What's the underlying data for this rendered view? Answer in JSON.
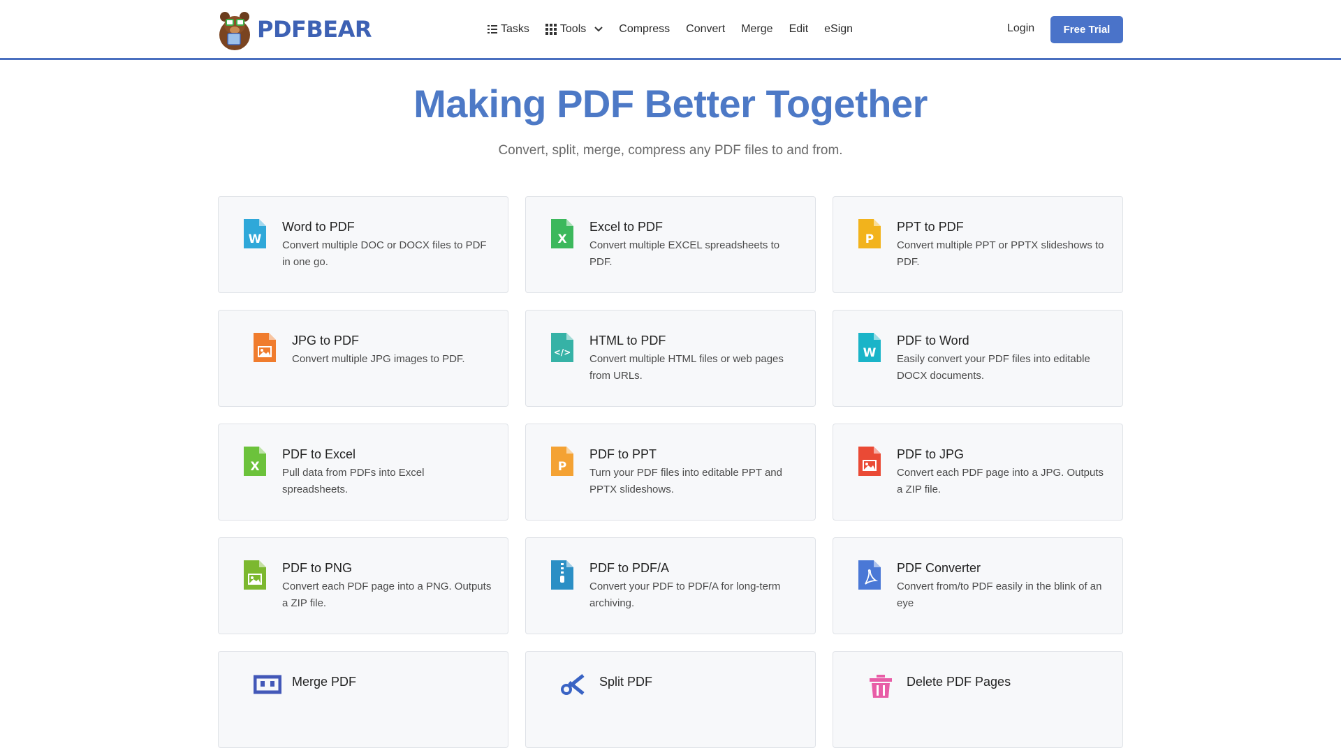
{
  "header": {
    "logo_pdf": "PDF",
    "logo_bear": "BEAR",
    "nav": [
      {
        "label": "Tasks",
        "icon": "list-icon"
      },
      {
        "label": "Tools",
        "icon": "grid-icon"
      },
      {
        "label": "Compress"
      },
      {
        "label": "Convert"
      },
      {
        "label": "Merge"
      },
      {
        "label": "Edit"
      },
      {
        "label": "eSign"
      }
    ],
    "login": "Login",
    "trial": "Free Trial",
    "accent": "#4a73c9"
  },
  "hero": {
    "title": "Making PDF Better Together",
    "subtitle": "Convert, split, merge, compress any PDF files to and from."
  },
  "tools": [
    {
      "title": "Word to PDF",
      "desc": "Convert multiple DOC or DOCX files to PDF in one go.",
      "icon": "word-file-icon",
      "color": "#2fa8d9",
      "letter": "W"
    },
    {
      "title": "Excel to PDF",
      "desc": "Convert multiple EXCEL spreadsheets to PDF.",
      "icon": "excel-file-icon",
      "color": "#3cb85c",
      "letter": "X"
    },
    {
      "title": "PPT to PDF",
      "desc": "Convert multiple PPT or PPTX slideshows to PDF.",
      "icon": "ppt-file-icon",
      "color": "#f2b31c",
      "letter": "P"
    },
    {
      "title": "JPG to PDF",
      "desc": "Convert multiple JPG images to PDF.",
      "icon": "jpg-file-icon",
      "color": "#f07c2d",
      "letter": ""
    },
    {
      "title": "HTML to PDF",
      "desc": "Convert multiple HTML files or web pages from URLs.",
      "icon": "html-file-icon",
      "color": "#36b2a6",
      "letter": "</>"
    },
    {
      "title": "PDF to Word",
      "desc": "Easily convert your PDF files into editable DOCX documents.",
      "icon": "pdf-word-file-icon",
      "color": "#1ab4c8",
      "letter": "W"
    },
    {
      "title": "PDF to Excel",
      "desc": "Pull data from PDFs into Excel spreadsheets.",
      "icon": "pdf-excel-file-icon",
      "color": "#6cc23b",
      "letter": "X"
    },
    {
      "title": "PDF to PPT",
      "desc": "Turn your PDF files into editable PPT and PPTX slideshows.",
      "icon": "pdf-ppt-file-icon",
      "color": "#f4a233",
      "letter": "P"
    },
    {
      "title": "PDF to JPG",
      "desc": "Convert each PDF page into a JPG. Outputs a ZIP file.",
      "icon": "pdf-jpg-file-icon",
      "color": "#ea4a35",
      "letter": ""
    },
    {
      "title": "PDF to PNG",
      "desc": "Convert each PDF page into a PNG. Outputs a ZIP file.",
      "icon": "pdf-png-file-icon",
      "color": "#7cb82f",
      "letter": ""
    },
    {
      "title": "PDF to PDF/A",
      "desc": "Convert your PDF to PDF/A for long-term archiving.",
      "icon": "pdfa-zip-file-icon",
      "color": "#2b8fc5",
      "letter": ""
    },
    {
      "title": "PDF Converter",
      "desc": "Convert from/to PDF easily in the blink of an eye",
      "icon": "pdf-converter-file-icon",
      "color": "#4a78d6",
      "letter": ""
    },
    {
      "title": "Merge PDF",
      "desc": "",
      "icon": "merge-icon",
      "color": "#4358b8",
      "letter": ""
    },
    {
      "title": "Split PDF",
      "desc": "",
      "icon": "scissors-icon",
      "color": "#3963c4",
      "letter": ""
    },
    {
      "title": "Delete PDF Pages",
      "desc": "",
      "icon": "trash-icon",
      "color": "#e85da7",
      "letter": ""
    }
  ]
}
